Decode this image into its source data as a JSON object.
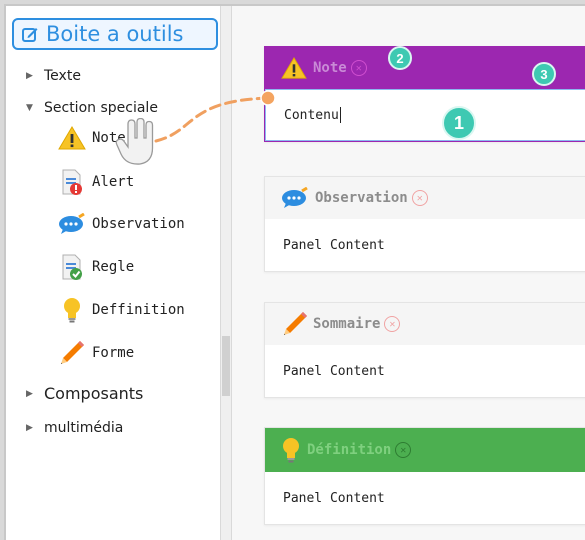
{
  "sidebar": {
    "title": "Boite a outils",
    "items": [
      {
        "label": "Texte",
        "expanded": false
      },
      {
        "label": "Section speciale",
        "expanded": true
      },
      {
        "label": "Composants",
        "expanded": false
      },
      {
        "label": "multimédia",
        "expanded": false
      }
    ],
    "sub_items": [
      {
        "label": "Note",
        "icon": "warning-icon"
      },
      {
        "label": "Alert",
        "icon": "alert-document-icon"
      },
      {
        "label": "Observation",
        "icon": "speech-bubble-icon"
      },
      {
        "label": "Regle",
        "icon": "check-document-icon"
      },
      {
        "label": "Deffinition",
        "icon": "lightbulb-icon"
      },
      {
        "label": "Forme",
        "icon": "pencil-icon"
      }
    ]
  },
  "panels": [
    {
      "title": "Note",
      "body": "Contenu",
      "header_color": "#9c27b0",
      "icon": "warning-icon"
    },
    {
      "title": "Observation",
      "body": "Panel Content",
      "header_color": "#f5f5f5",
      "icon": "speech-bubble-icon"
    },
    {
      "title": "Sommaire",
      "body": "Panel Content",
      "header_color": "#f5f5f5",
      "icon": "pencil-icon"
    },
    {
      "title": "Définition",
      "body": "Panel Content",
      "header_color": "#4caf50",
      "icon": "lightbulb-icon"
    }
  ],
  "badges": [
    "1",
    "2",
    "3"
  ],
  "colors": {
    "accent": "#2e8fe0",
    "badge": "#3ec9b2",
    "drag_line": "#f0a060"
  }
}
